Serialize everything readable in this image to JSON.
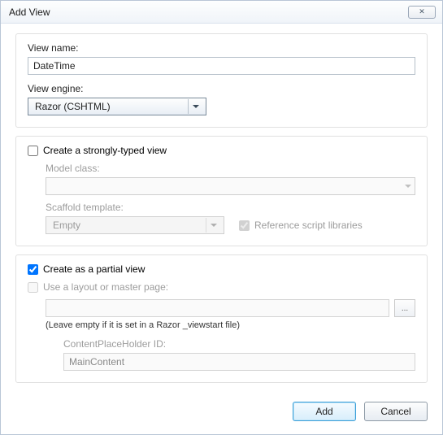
{
  "window": {
    "title": "Add View"
  },
  "labels": {
    "viewName": "View name:",
    "viewEngine": "View engine:",
    "stronglyTyped": "Create a strongly-typed view",
    "modelClass": "Model class:",
    "scaffoldTemplate": "Scaffold template:",
    "referenceScripts": "Reference script libraries",
    "partialView": "Create as a partial view",
    "useLayout": "Use a layout or master page:",
    "hint": "(Leave empty if it is set in a Razor _viewstart file)",
    "placeholderId": "ContentPlaceHolder ID:"
  },
  "values": {
    "viewName": "DateTime",
    "viewEngine": "Razor (CSHTML)",
    "scaffold": "Empty",
    "placeholder": "MainContent"
  },
  "checks": {
    "stronglyTyped": false,
    "referenceScripts": true,
    "partialView": true,
    "useLayout": false
  },
  "buttons": {
    "browse": "...",
    "add": "Add",
    "cancel": "Cancel"
  }
}
